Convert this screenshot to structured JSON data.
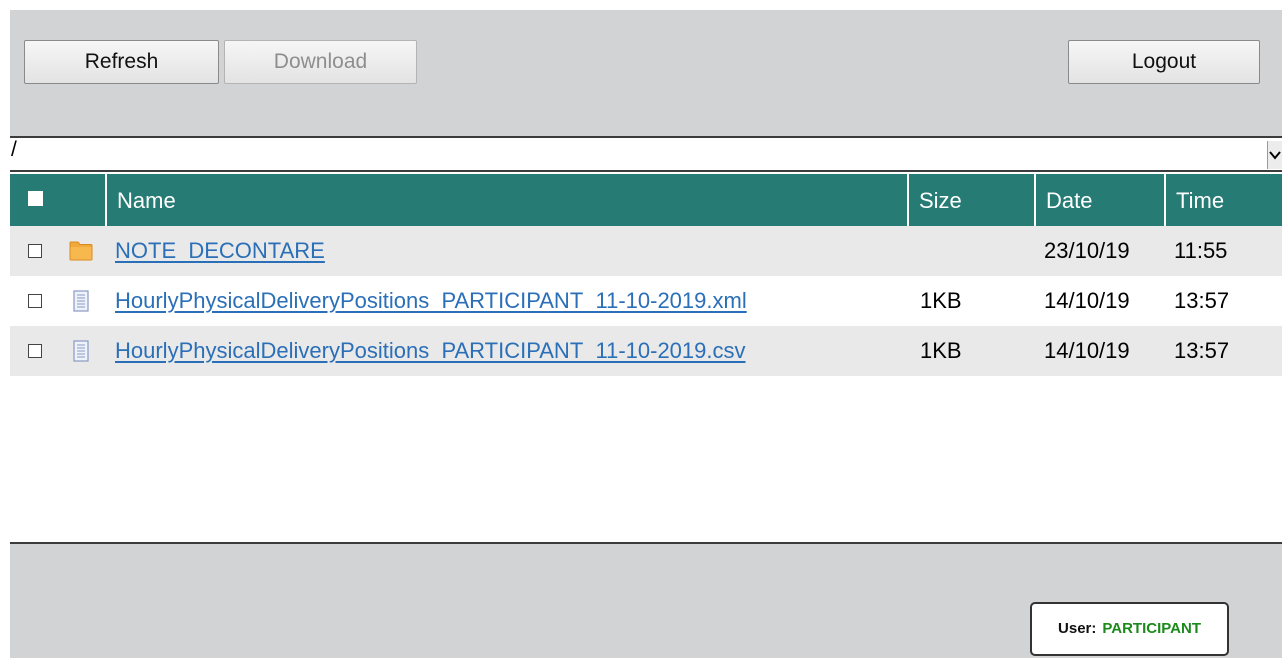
{
  "toolbar": {
    "refresh_label": "Refresh",
    "download_label": "Download",
    "logout_label": "Logout"
  },
  "path": {
    "value": "/"
  },
  "table": {
    "columns": {
      "name": "Name",
      "size": "Size",
      "date": "Date",
      "time": "Time"
    },
    "rows": [
      {
        "type": "folder",
        "icon": "folder-icon",
        "name": "NOTE_DECONTARE",
        "size": "",
        "date": "23/10/19",
        "time": "11:55"
      },
      {
        "type": "file",
        "icon": "file-icon",
        "name": "HourlyPhysicalDeliveryPositions_PARTICIPANT_11-10-2019.xml",
        "size": "1KB",
        "date": "14/10/19",
        "time": "13:57"
      },
      {
        "type": "file",
        "icon": "file-icon",
        "name": "HourlyPhysicalDeliveryPositions_PARTICIPANT_11-10-2019.csv",
        "size": "1KB",
        "date": "14/10/19",
        "time": "13:57"
      }
    ]
  },
  "footer": {
    "user_label": "User:",
    "user_name": "PARTICIPANT"
  },
  "colors": {
    "header_bg": "#267b74",
    "link": "#2a6fb8",
    "user_name": "#1b8a1b",
    "folder": "#f2a93b",
    "toolbar_bg": "#d2d3d5"
  }
}
